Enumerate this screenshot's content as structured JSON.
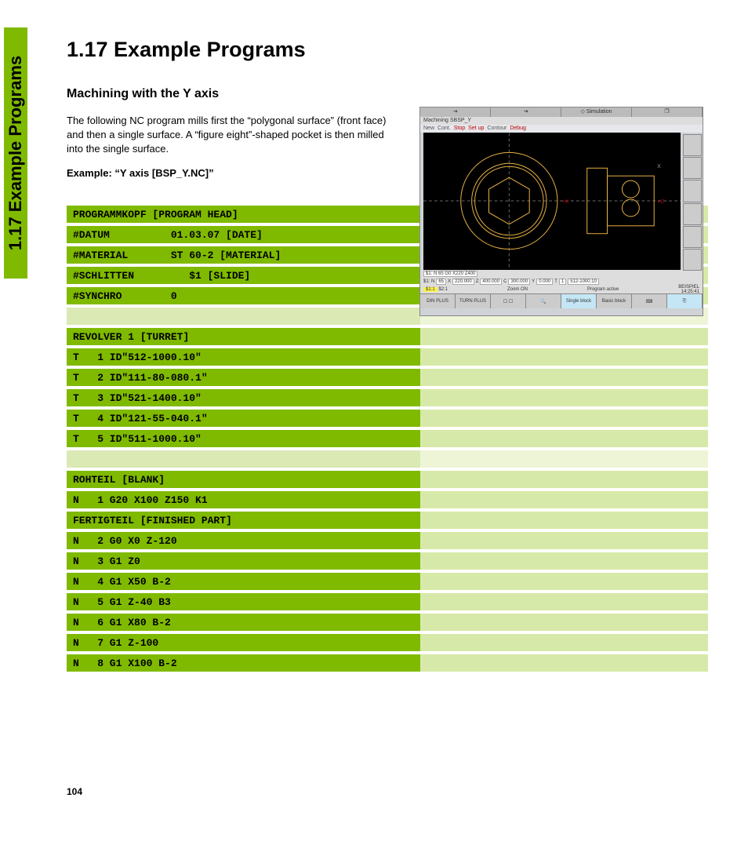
{
  "sideTab": "1.17 Example Programs",
  "heading": "1.17 Example Programs",
  "subheading": "Machining with the Y axis",
  "bodyText": "The following NC program mills first the “polygonal surface” (front face) and then a single surface. A “figure eight”-shaped pocket is then milled into the single surface.",
  "exampleLabel": "Example: “Y axis [BSP_Y.NC]”",
  "screenshot": {
    "topTabs": [
      "⇥",
      "⇥",
      "◇ Simulation",
      "❐"
    ],
    "machining": "Machining    SBSP_Y",
    "toolbar": {
      "new": "New",
      "cont": "Cont.",
      "stop": "Stop",
      "setup": "Set up",
      "contour": "Contour",
      "debug": "Debug"
    },
    "status1": {
      "line": "$1: N  65 G0 X220 Z400",
      "n": "65",
      "x": "220.000",
      "z": "400.000",
      "c": "300.000",
      "y": "0.000",
      "t": "1",
      "tool": "512-1000.10"
    },
    "status2": {
      "s1": "$1:1",
      "s2": "$2:1",
      "zoom": "Zoom ON",
      "active": "Program active",
      "beispiel": "BEISPIEL",
      "time": "14:25:41"
    },
    "bottom": {
      "din": "DIN PLUS",
      "turn": "TURN PLUS",
      "single": "Single block",
      "basic": "Basic block"
    }
  },
  "code": [
    {
      "c1": "PROGRAMMKOPF [PROGRAM HEAD]",
      "c2": "",
      "s": "dark"
    },
    {
      "c1": "#DATUM          01.03.07 [DATE]",
      "c2": "",
      "s": "dark"
    },
    {
      "c1": "#MATERIAL       ST 60-2 [MATERIAL]",
      "c2": "",
      "s": "dark"
    },
    {
      "c1": "#SCHLITTEN         $1 [SLIDE]",
      "c2": "",
      "s": "dark"
    },
    {
      "c1": "#SYNCHRO        0",
      "c2": "",
      "s": "dark"
    },
    {
      "c1": "",
      "c2": "",
      "s": "light"
    },
    {
      "c1": "REVOLVER 1 [TURRET]",
      "c2": "",
      "s": "dark"
    },
    {
      "c1": "T   1 ID\"512-1000.10\"",
      "c2": "",
      "s": "dark"
    },
    {
      "c1": "T   2 ID\"111-80-080.1\"",
      "c2": "",
      "s": "dark"
    },
    {
      "c1": "T   3 ID\"521-1400.10\"",
      "c2": "",
      "s": "dark"
    },
    {
      "c1": "T   4 ID\"121-55-040.1\"",
      "c2": "",
      "s": "dark"
    },
    {
      "c1": "T   5 ID\"511-1000.10\"",
      "c2": "",
      "s": "dark"
    },
    {
      "c1": "",
      "c2": "",
      "s": "light"
    },
    {
      "c1": "ROHTEIL [BLANK]",
      "c2": "",
      "s": "dark"
    },
    {
      "c1": "N   1 G20 X100 Z150 K1",
      "c2": "",
      "s": "dark"
    },
    {
      "c1": "FERTIGTEIL [FINISHED PART]",
      "c2": "",
      "s": "dark"
    },
    {
      "c1": "N   2 G0 X0 Z-120",
      "c2": "",
      "s": "dark"
    },
    {
      "c1": "N   3 G1 Z0",
      "c2": "",
      "s": "dark"
    },
    {
      "c1": "N   4 G1 X50 B-2",
      "c2": "",
      "s": "dark"
    },
    {
      "c1": "N   5 G1 Z-40 B3",
      "c2": "",
      "s": "dark"
    },
    {
      "c1": "N   6 G1 X80 B-2",
      "c2": "",
      "s": "dark"
    },
    {
      "c1": "N   7 G1 Z-100",
      "c2": "",
      "s": "dark"
    },
    {
      "c1": "N   8 G1 X100 B-2",
      "c2": "",
      "s": "dark"
    }
  ],
  "pageNum": "104"
}
